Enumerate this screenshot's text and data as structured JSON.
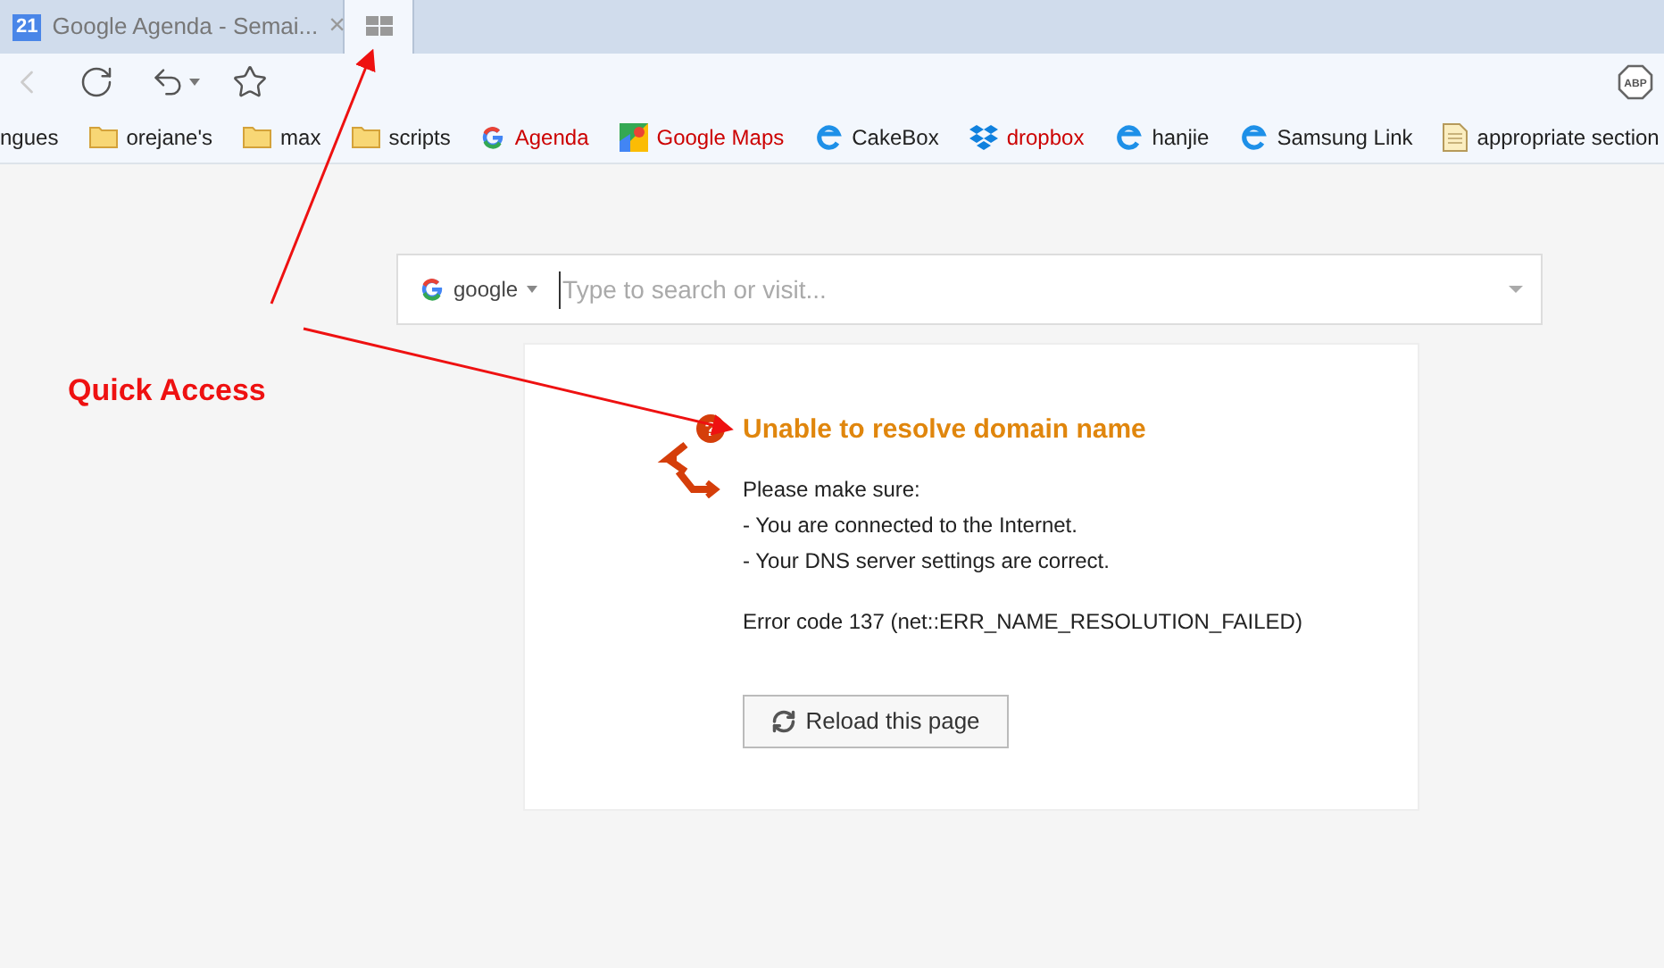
{
  "tabs": [
    {
      "kind": "page",
      "badge": "21",
      "title": "Google Agenda - Semai...",
      "close": "×",
      "selected": false
    },
    {
      "kind": "quick_access",
      "selected": true
    }
  ],
  "bookmarks": [
    {
      "kind": "text",
      "label": "ngues",
      "color": "#222222"
    },
    {
      "kind": "folder",
      "label": "orejane's",
      "color": "#222222"
    },
    {
      "kind": "folder",
      "label": "max",
      "color": "#222222"
    },
    {
      "kind": "folder",
      "label": "scripts",
      "color": "#222222"
    },
    {
      "kind": "google",
      "label": "Agenda",
      "color": "#cc0000"
    },
    {
      "kind": "maps",
      "label": "Google Maps",
      "color": "#cc0000"
    },
    {
      "kind": "ie",
      "label": "CakeBox",
      "color": "#222222"
    },
    {
      "kind": "dropbox",
      "label": "dropbox",
      "color": "#cc0000"
    },
    {
      "kind": "ie",
      "label": "hanjie",
      "color": "#222222"
    },
    {
      "kind": "ie",
      "label": "Samsung Link",
      "color": "#222222"
    },
    {
      "kind": "page",
      "label": "appropriate section",
      "color": "#222222"
    }
  ],
  "search": {
    "engine": "google",
    "placeholder": "Type to search or visit..."
  },
  "error": {
    "title": "Unable to resolve domain name",
    "lines": [
      "Please make sure:",
      "- You are connected to the Internet.",
      "- Your DNS server settings are correct."
    ],
    "code": "Error code 137 (net::ERR_NAME_RESOLUTION_FAILED)",
    "button": "Reload this page"
  },
  "annotation": {
    "label": "Quick Access"
  },
  "toolbar": {
    "abp_label": "ABP"
  },
  "error_icon": {
    "mark": "?"
  }
}
